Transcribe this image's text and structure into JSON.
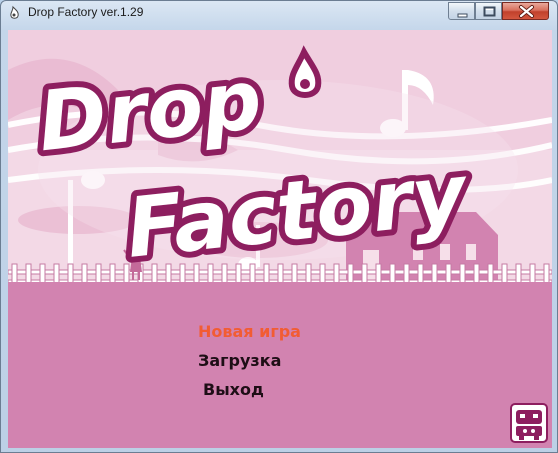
{
  "window": {
    "title": "Drop Factory ver.1.29",
    "icons": {
      "app": "drop-icon",
      "minimize": "minimize-icon",
      "maximize": "maximize-icon",
      "close": "close-icon"
    }
  },
  "game": {
    "logo": {
      "line1": "Drop",
      "line2": "Factory"
    },
    "menu": {
      "new_game": "Новая игра",
      "load": "Загрузка",
      "quit": "Выход"
    },
    "colors": {
      "highlight": "#f25c33",
      "menu_text": "#1e0e16",
      "ground": "#d283b0",
      "sky": "#f3d9e6",
      "logo_outline": "#8d1e5f"
    },
    "corner_icon": "cow-logo-icon"
  }
}
